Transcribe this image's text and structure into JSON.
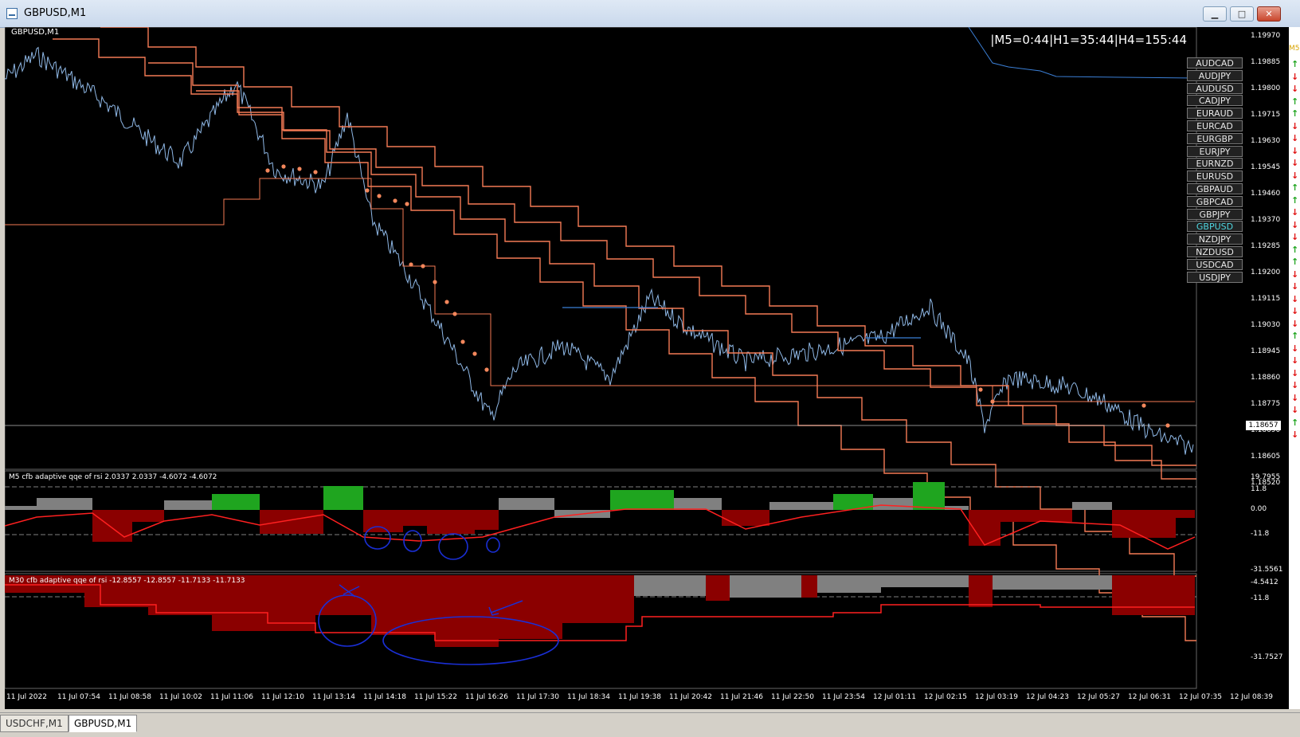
{
  "window": {
    "title": "GBPUSD,M1",
    "min_glyph": "▁",
    "max_glyph": "□",
    "close_glyph": "✕"
  },
  "chart": {
    "symbol_label": "GBPUSD,M1",
    "timer_text": "|M5=0:44|H1=35:44|H4=155:44",
    "current_price": "1.18657",
    "price_axis": [
      "1.19970",
      "1.19885",
      "1.19800",
      "1.19715",
      "1.19630",
      "1.19545",
      "1.19460",
      "1.19370",
      "1.19285",
      "1.19200",
      "1.19115",
      "1.19030",
      "1.18945",
      "1.18860",
      "1.18775",
      "1.18690",
      "1.18605",
      "1.18520"
    ],
    "time_axis": [
      "11 Jul 2022",
      "11 Jul 07:54",
      "11 Jul 08:58",
      "11 Jul 10:02",
      "11 Jul 11:06",
      "11 Jul 12:10",
      "11 Jul 13:14",
      "11 Jul 14:18",
      "11 Jul 15:22",
      "11 Jul 16:26",
      "11 Jul 17:30",
      "11 Jul 18:34",
      "11 Jul 19:38",
      "11 Jul 20:42",
      "11 Jul 21:46",
      "11 Jul 22:50",
      "11 Jul 23:54",
      "12 Jul 01:11",
      "12 Jul 02:15",
      "12 Jul 03:19",
      "12 Jul 04:23",
      "12 Jul 05:27",
      "12 Jul 06:31",
      "12 Jul 07:35",
      "12 Jul 08:39"
    ],
    "symbols": [
      "AUDCAD",
      "AUDJPY",
      "AUDUSD",
      "CADJPY",
      "EURAUD",
      "EURCAD",
      "EURGBP",
      "EURJPY",
      "EURNZD",
      "EURUSD",
      "GBPAUD",
      "GBPCAD",
      "GBPJPY",
      "GBPUSD",
      "NZDJPY",
      "NZDUSD",
      "USDCAD",
      "USDJPY"
    ],
    "active_symbol": "GBPUSD"
  },
  "indicator_m5": {
    "label": "M5  cfb adaptive qqe of rsi 2.0337 2.0337 -4.6072 -4.6072",
    "axis": [
      "19.7955",
      "11.8",
      "0.00",
      "-11.8",
      "-31.5561"
    ]
  },
  "indicator_m30": {
    "label": "M30  cfb adaptive qqe of rsi -12.8557 -12.8557 -11.7133 -11.7133",
    "axis": [
      "-4.5412",
      "-11.8",
      "-31.7527"
    ]
  },
  "side_label": "M5",
  "arrows": [
    "up",
    "down",
    "down",
    "up",
    "up",
    "down",
    "down",
    "down",
    "down",
    "down",
    "up",
    "up",
    "down",
    "down",
    "down",
    "up",
    "up",
    "down",
    "down",
    "down",
    "down",
    "down",
    "up",
    "down",
    "down",
    "down",
    "down",
    "down",
    "down",
    "up",
    "down"
  ],
  "tabs": [
    "USDCHF,M1",
    "GBPUSD,M1"
  ],
  "active_tab": "GBPUSD,M1",
  "colors": {
    "price_line": "#8fb8e6",
    "level_line": "#f47a55",
    "bull": "#1fa51f",
    "bear": "#8b0000",
    "neutral": "#808080",
    "signal": "#ff2020"
  }
}
